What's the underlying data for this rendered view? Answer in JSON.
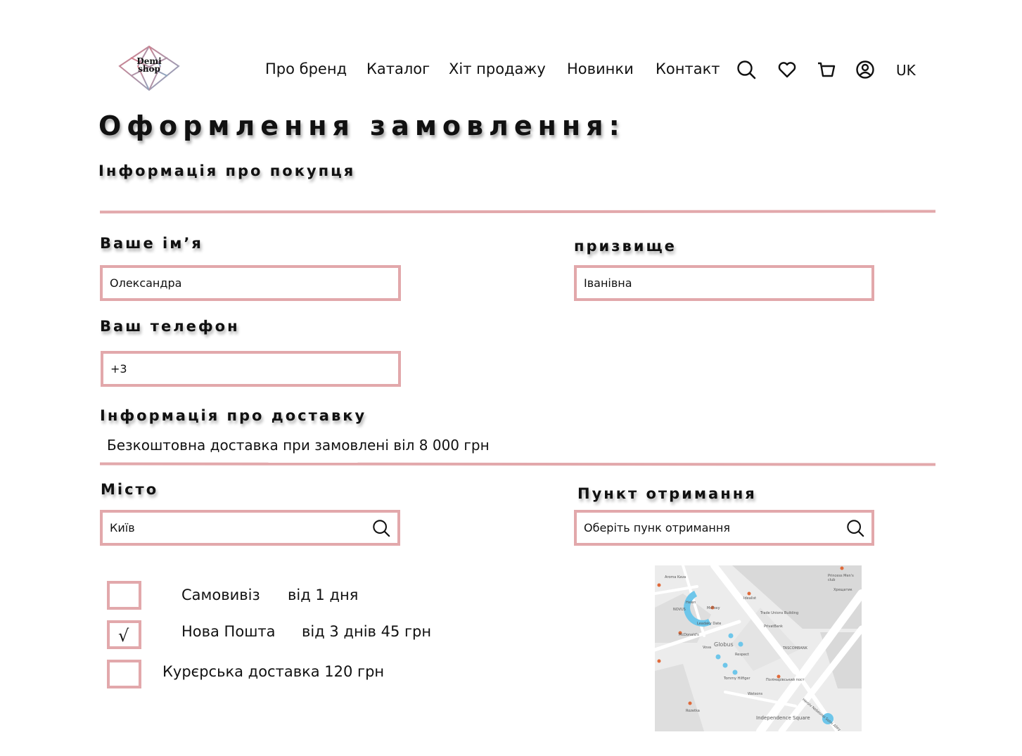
{
  "brand": {
    "logo_line1": "Demi",
    "logo_line2": "shop"
  },
  "nav": {
    "items": [
      "Про бренд",
      "Каталог",
      "Хіт продажу",
      "Новинки",
      "Контакт"
    ],
    "icons": [
      "search-icon",
      "heart-icon",
      "cart-icon",
      "account-icon"
    ],
    "lang": "UK"
  },
  "page": {
    "title": "Оформлення замовлення:",
    "buyer_heading": "Інформація про покупця"
  },
  "form": {
    "first_name_label": "Ваше ім’я",
    "first_name_value": "Олександра",
    "last_name_label": "призвище",
    "last_name_value": "Іванівна",
    "phone_label": "Ваш телефон",
    "phone_value": "+3"
  },
  "delivery": {
    "heading": "Інформація про доставку",
    "note": "Безкоштовна доставка при замовлені віл 8 000 грн",
    "city_label": "Місто",
    "city_value": "Київ",
    "pickup_label": "Пункт отримання",
    "pickup_placeholder": "Оберіть пунк отримання",
    "options": [
      {
        "name": "Самовивіз",
        "detail": "від 1 дня",
        "checked": false
      },
      {
        "name": "Нова Пошта",
        "detail": "від 3 днів 45 грн",
        "checked": true
      },
      {
        "name": "Курєрська доставка 120 грн",
        "detail": "",
        "checked": false
      }
    ],
    "check_mark": "√"
  },
  "map": {
    "labels": [
      "Globus",
      "TASCOMBANK",
      "Trade Unions Building",
      "PrivatBank",
      "Independence Square",
      "McFoxy",
      "Idealist",
      "Leadaky Date",
      "McDonald's",
      "Vova",
      "Respect",
      "Tommy Hilfiger",
      "Watsons",
      "Rozetka",
      "Princess Men's club",
      "Хрещатик",
      "Aroma Kava",
      "NOVUS",
      "Helen",
      "Полімарівський пост",
      "Heroiv Nebesnoi Sotni Alley"
    ],
    "colors": {
      "road": "#ffffff",
      "block": "#d9d9d9",
      "water": "#6ec6ea",
      "poi": "#e06a3a"
    }
  },
  "colors": {
    "accent": "#e2a8ab",
    "logo_rose": "#d67d8a",
    "logo_blue": "#8aa7c2"
  }
}
